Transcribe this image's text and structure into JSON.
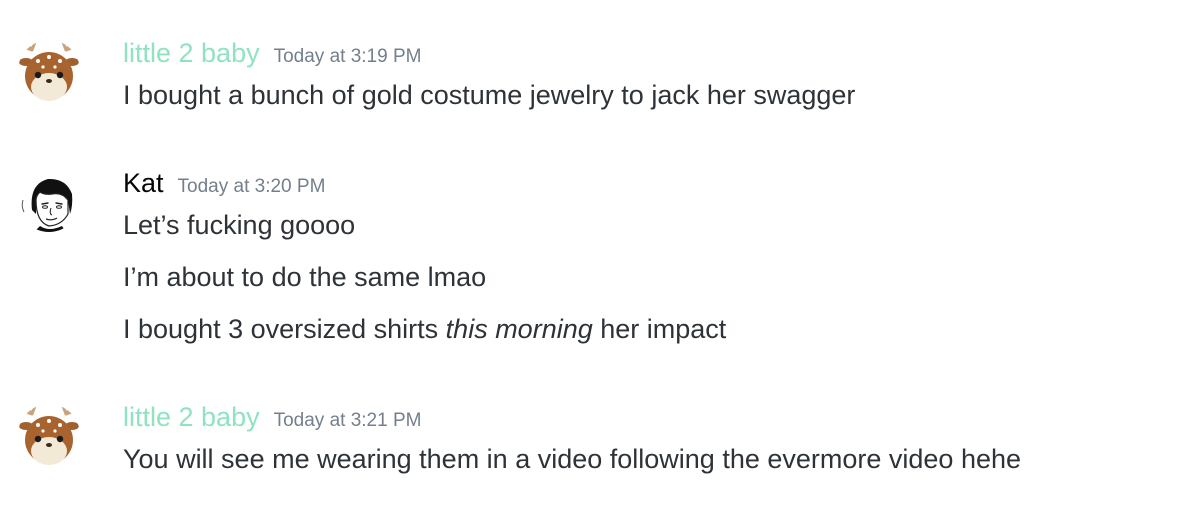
{
  "colors": {
    "username_green": "#8fe3c0",
    "username_default": "#060607",
    "timestamp": "#747f8d",
    "text": "#2e3338"
  },
  "groups": [
    {
      "avatar": "fawn-plush-avatar",
      "username": "little 2 baby",
      "username_color": "#8fe3c0",
      "timestamp": "Today at 3:19 PM",
      "messages": [
        {
          "text": "I bought a bunch of gold costume jewelry to jack her swagger"
        }
      ]
    },
    {
      "avatar": "sketch-face-avatar",
      "username": "Kat",
      "username_color": "#060607",
      "timestamp": "Today at 3:20 PM",
      "messages": [
        {
          "text": "Let’s fucking goooo"
        },
        {
          "text": "I’m about to do the same lmao"
        },
        {
          "before": "I bought 3 oversized shirts ",
          "italic": "this morning",
          "after": " her impact"
        }
      ]
    },
    {
      "avatar": "fawn-plush-avatar",
      "username": "little 2 baby",
      "username_color": "#8fe3c0",
      "timestamp": "Today at 3:21 PM",
      "messages": [
        {
          "text": "You will see me wearing them in a video following the evermore video hehe"
        }
      ]
    }
  ]
}
